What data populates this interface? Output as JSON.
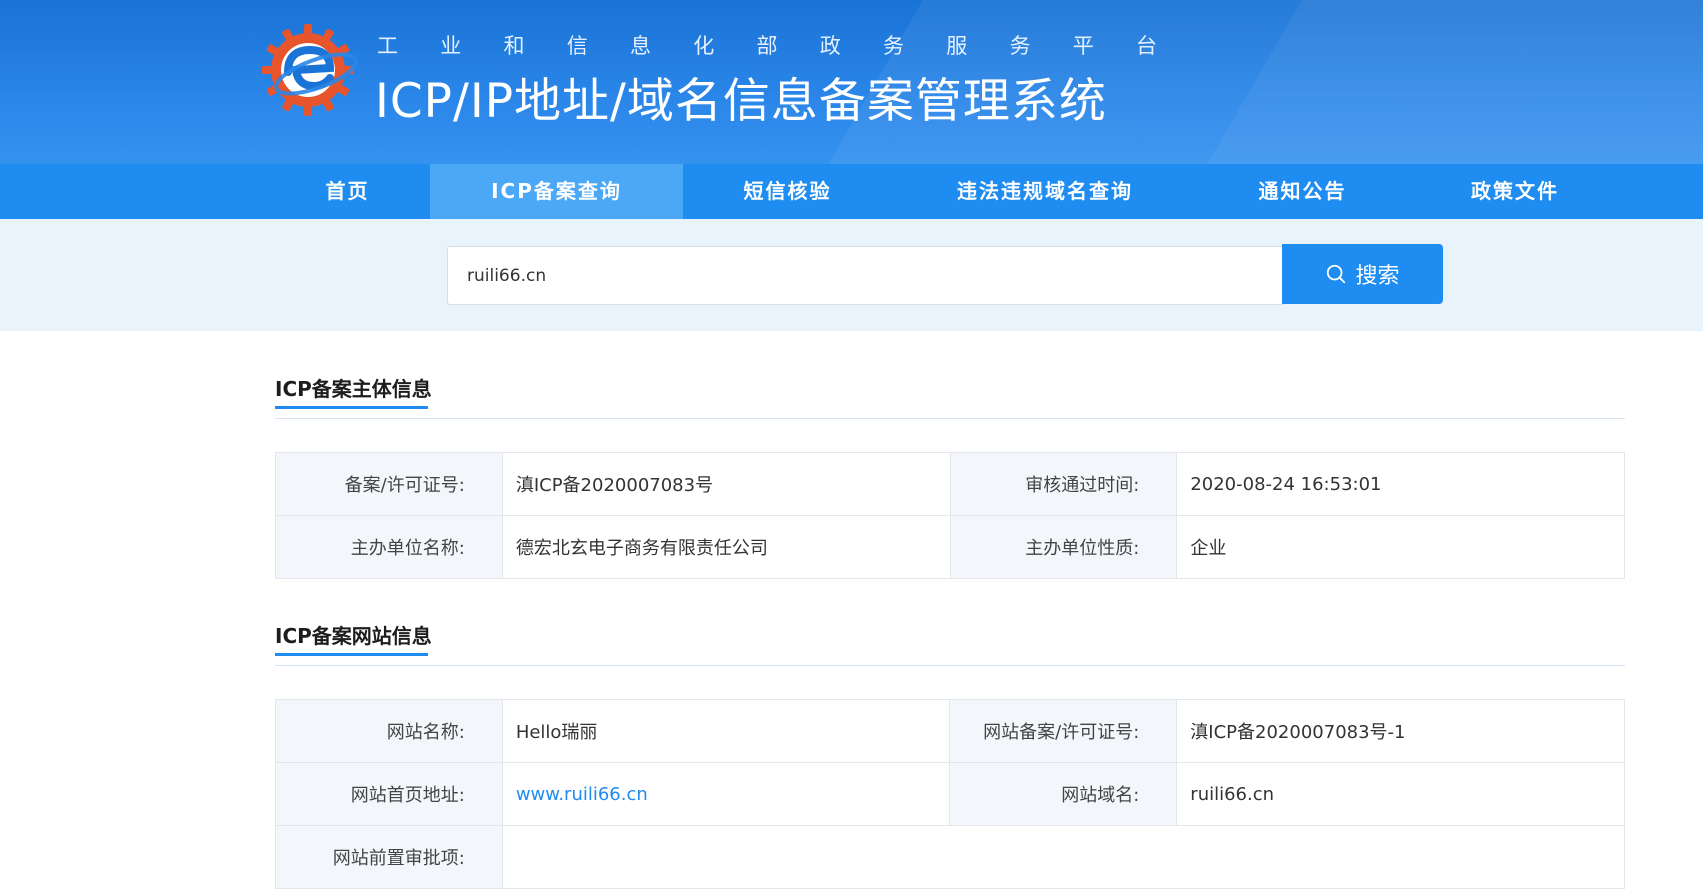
{
  "header": {
    "subtitle_chars": [
      "工",
      "业",
      "和",
      "信",
      "息",
      "化",
      "部",
      "政",
      "务",
      "服",
      "务",
      "平",
      "台"
    ],
    "title": "ICP/IP地址/域名信息备案管理系统",
    "logo_icon": "miit-logo-icon"
  },
  "nav": {
    "items": [
      {
        "label": "首页"
      },
      {
        "label": "ICP备案查询",
        "active": true
      },
      {
        "label": "短信核验"
      },
      {
        "label": "违法违规域名查询"
      },
      {
        "label": "通知公告"
      },
      {
        "label": "政策文件"
      }
    ]
  },
  "search": {
    "value": "ruili66.cn",
    "button_label": "搜索",
    "button_icon": "search-icon"
  },
  "sections": {
    "subject": {
      "title": "ICP备案主体信息",
      "rows": [
        {
          "l1": "备案/许可证号:",
          "v1": "滇ICP备2020007083号",
          "l2": "审核通过时间:",
          "v2": "2020-08-24 16:53:01"
        },
        {
          "l1": "主办单位名称:",
          "v1": "德宏北玄电子商务有限责任公司",
          "l2": "主办单位性质:",
          "v2": "企业"
        }
      ]
    },
    "website": {
      "title": "ICP备案网站信息",
      "rows": [
        {
          "l1": "网站名称:",
          "v1": "Hello瑞丽",
          "l2": "网站备案/许可证号:",
          "v2": "滇ICP备2020007083号-1"
        },
        {
          "l1": "网站首页地址:",
          "v1": "www.ruili66.cn",
          "l2": "网站域名:",
          "v2": "ruili66.cn"
        },
        {
          "l1": "网站前置审批项:",
          "v1": "",
          "l2": "",
          "v2": ""
        }
      ]
    }
  },
  "colors": {
    "primary": "#1e8cf0",
    "nav_active": "#4aa8f7",
    "header_top": "#1a73d6",
    "label_bg": "#f3f7fb",
    "search_band": "#e9f3fc"
  }
}
